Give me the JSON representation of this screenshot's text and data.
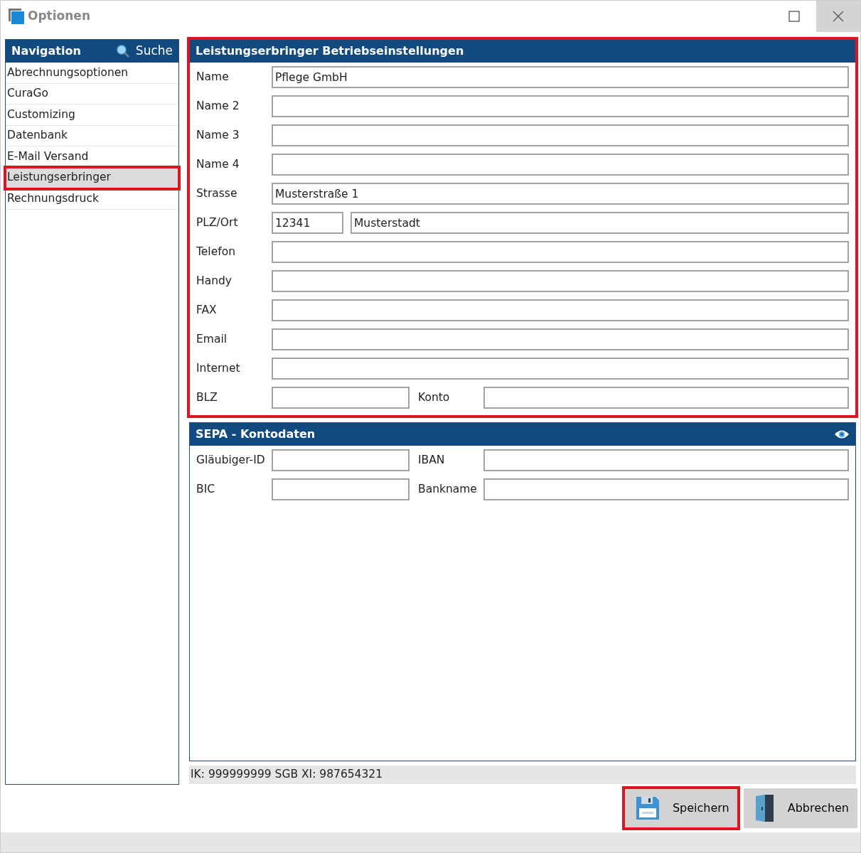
{
  "window": {
    "title": "Optionen"
  },
  "navigation": {
    "title": "Navigation",
    "search_label": "Suche",
    "items": [
      {
        "label": "Abrechnungsoptionen",
        "selected": false,
        "highlighted": false
      },
      {
        "label": "CuraGo",
        "selected": false,
        "highlighted": false
      },
      {
        "label": "Customizing",
        "selected": false,
        "highlighted": false
      },
      {
        "label": "Datenbank",
        "selected": false,
        "highlighted": false
      },
      {
        "label": "E-Mail Versand",
        "selected": false,
        "highlighted": false
      },
      {
        "label": "Leistungserbringer",
        "selected": true,
        "highlighted": true
      },
      {
        "label": "Rechnungsdruck",
        "selected": false,
        "highlighted": false
      }
    ]
  },
  "panels": [
    {
      "title": "Leistungserbringer Betriebseinstellungen",
      "highlighted": true,
      "rows": [
        {
          "kind": "single",
          "label": "Name",
          "value": "Pflege GmbH"
        },
        {
          "kind": "single",
          "label": "Name 2"
        },
        {
          "kind": "single",
          "label": "Name 3"
        },
        {
          "kind": "single",
          "label": "Name 4"
        },
        {
          "kind": "single",
          "label": "Strasse",
          "value": "Musterstraße 1"
        },
        {
          "kind": "split",
          "label": "PLZ/Ort",
          "value": "12341",
          "value2": "Musterstadt"
        },
        {
          "kind": "single",
          "label": "Telefon"
        },
        {
          "kind": "single",
          "label": "Handy"
        },
        {
          "kind": "single",
          "label": "FAX"
        },
        {
          "kind": "single",
          "label": "Email"
        },
        {
          "kind": "single",
          "label": "Internet"
        },
        {
          "kind": "pair",
          "label": "BLZ",
          "label2": "Konto"
        }
      ]
    },
    {
      "title": "SEPA - Kontodaten",
      "highlighted": false,
      "has_eye": true,
      "rows": [
        {
          "kind": "pair",
          "label": "Gläubiger-ID",
          "label2": "IBAN"
        },
        {
          "kind": "pair",
          "label": "BIC",
          "label2": "Bankname"
        }
      ]
    }
  ],
  "status_bar": "IK: 999999999 SGB XI: 987654321",
  "buttons": [
    {
      "label": "Speichern",
      "kind": "save",
      "highlighted": true
    },
    {
      "label": "Abbrechen",
      "kind": "cancel",
      "highlighted": false
    }
  ]
}
